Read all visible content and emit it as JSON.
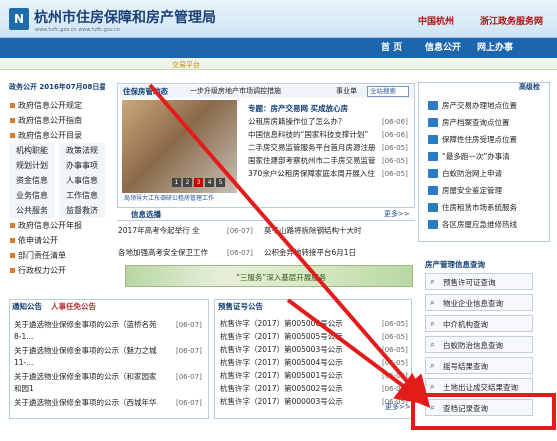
{
  "header": {
    "logo_glyph": "N",
    "site_title": "杭州市住房保障和房产管理局",
    "site_url": "www.hzfc.gov.cn  www.hzfc.gov.cn",
    "brand_1": "中国杭州",
    "brand_2": "浙江政务服务网"
  },
  "nav": {
    "items": [
      "首 页",
      "信息公开",
      "网上办事"
    ]
  },
  "subbar": {
    "tab": "交易平台"
  },
  "left": {
    "header_date": "政务公开    2016年07月08日星期五",
    "items": [
      {
        "t": "full",
        "label": "政府信息公开规定"
      },
      {
        "t": "full",
        "label": "政府信息公开指南"
      },
      {
        "t": "full",
        "label": "政府信息公开目录"
      },
      {
        "t": "half",
        "labels": [
          "机构职能",
          "政策法规"
        ]
      },
      {
        "t": "half",
        "labels": [
          "规划计划",
          "办事事项"
        ]
      },
      {
        "t": "half",
        "labels": [
          "资金信息",
          "人事信息"
        ]
      },
      {
        "t": "half",
        "labels": [
          "业务信息",
          "工作信息"
        ]
      },
      {
        "t": "half",
        "labels": [
          "公共服务",
          "监督救济"
        ]
      },
      {
        "t": "full",
        "label": "政府信息公开年报"
      },
      {
        "t": "full",
        "label": "依申请公开"
      },
      {
        "t": "full",
        "label": "部门责任清单"
      },
      {
        "t": "full",
        "label": "行政权力公开"
      }
    ]
  },
  "main": {
    "head_title": "住保房管动态",
    "head_ticker": "一步升级房地产市场调控措施",
    "head_select": "全站搜索",
    "head_tag": "事业单",
    "photo_caption": "局领导大江东调研公租房管理工作",
    "photo_pages": [
      "1",
      "2",
      "3",
      "4",
      "5"
    ],
    "news": [
      {
        "text": "专题：房产交易网 买成放心房",
        "date": ""
      },
      {
        "text": "公租房房籍操作位了怎么办？",
        "date": "[06-06]"
      },
      {
        "text": "中国信息科技的“国家科技支撑计划”",
        "date": "[06-06]"
      },
      {
        "text": "二手房交易监管服务平台首月房源注册",
        "date": "[06-05]"
      },
      {
        "text": "国家住建部考察杭州市二手房交易监管",
        "date": "[06-05]"
      },
      {
        "text": "370余户公租房保障家庭本周开展入住",
        "date": "[06-05]"
      }
    ],
    "info_title": "信息选播",
    "more": "更多>>",
    "info": [
      {
        "text": "2017年高考今起举行 全",
        "date": "[06-07]",
        "text2": "莫干山路将拆除钢结构十大时"
      },
      {
        "text": "各地加强高考安全保卫工作",
        "date": "[06-07]",
        "text2": "公积金异地转接平台6月1日"
      }
    ],
    "banner": "“三服务”深入基层开展服务"
  },
  "right": {
    "title": "高级检",
    "links": [
      "房产交易办理地点位置",
      "房产档案查询点位置",
      "保障性住房受理点位置",
      "“最多跑一次”办事清",
      "白蚁防治网上申请",
      "房屋安全鉴定管理",
      "住房租赁市场系统服务",
      "各区房屋应急维修热线"
    ]
  },
  "query": {
    "title": "房产管理信息查询",
    "buttons": [
      "预售许可证查询",
      "物业企业信息查询",
      "中介机构查询",
      "白蚁防治信息查询",
      "摇号结果查询",
      "土地出让成交结果查询",
      "查档记录查询"
    ]
  },
  "bottom_left": {
    "tabs": [
      "通知公告",
      "人事任免公告"
    ],
    "rows": [
      {
        "text": "关于遴选物业保修金事项的公示（蓝桥名苑",
        "date": "[06-07]",
        "sub": "8-1..."
      },
      {
        "text": "关于遴选物业保修金事项的公示（魅力之城",
        "date": "[06-07]",
        "sub": "11-..."
      },
      {
        "text": "关于遴选物业保修金事项的公示（和家园家",
        "date": "[06-07]",
        "sub": "和园1"
      },
      {
        "text": "关于遴选物业保修金事项的公示（西城年华",
        "date": "[06-07]",
        "sub": ""
      }
    ]
  },
  "bottom_mid": {
    "tab": "预售证号公告",
    "rows": [
      {
        "text": "杭售许字（2017）第005006号公示",
        "date": "[06-05]"
      },
      {
        "text": "杭售许字（2017）第005005号公示",
        "date": "[06-05]"
      },
      {
        "text": "杭售许字（2017）第005003号公示",
        "date": "[06-05]"
      },
      {
        "text": "杭售许字（2017）第005004号公示",
        "date": "[06-05]"
      },
      {
        "text": "杭售许字（2017）第005001号公示",
        "date": "[06-05]"
      },
      {
        "text": "杭售许字（2017）第005002号公示",
        "date": "[06-05]"
      },
      {
        "text": "杭售许字（2017）第000003号公示",
        "date": "[06-05]"
      }
    ],
    "more": "更多>>"
  },
  "colors": {
    "nav": "#1c66ad",
    "highlight": "#e41b1b",
    "arrow": "#e41b1b"
  }
}
